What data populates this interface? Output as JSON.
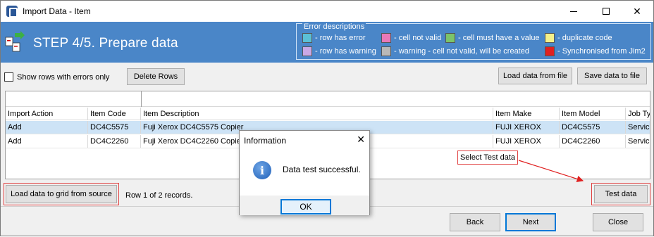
{
  "window": {
    "title": "Import Data - Item"
  },
  "header": {
    "step_title": "STEP 4/5. Prepare data",
    "error_descriptions": {
      "title": "Error descriptions",
      "items": [
        {
          "label": "- row has error",
          "color": "#5bc0d6"
        },
        {
          "label": "- cell not valid",
          "color": "#e879b8"
        },
        {
          "label": "- cell must have a value",
          "color": "#7cc46a"
        },
        {
          "label": "- duplicate code",
          "color": "#f4f08a"
        },
        {
          "label": "- row has warning",
          "color": "#c9a8e6"
        },
        {
          "label": "- warning - cell not valid, will be created",
          "color": "#b8b8b8"
        },
        {
          "label": "- Synchronised from Jim2",
          "color": "#e02020"
        }
      ]
    }
  },
  "toolbar": {
    "show_errors_label": "Show rows with errors only",
    "delete_rows": "Delete Rows",
    "load_from_file": "Load data from file",
    "save_to_file": "Save data to file"
  },
  "grid": {
    "columns": [
      "Import Action",
      "Item Code",
      "Item Description",
      "Item Make",
      "Item Model",
      "Job Ty"
    ],
    "rows": [
      [
        "Add",
        "DC4C5575",
        "Fuji Xerox DC4C5575 Copier",
        "FUJI XEROX",
        "DC4C5575",
        "Service"
      ],
      [
        "Add",
        "DC4C2260",
        "Fuji Xerox DC4C2260 Copier",
        "FUJI XEROX",
        "DC4C2260",
        "Service"
      ]
    ]
  },
  "bottom": {
    "load_grid_from_source": "Load data to grid from source",
    "status": "Row 1 of 2 records.",
    "test_data": "Test data",
    "back": "Back",
    "next": "Next",
    "close": "Close"
  },
  "dialog": {
    "title": "Information",
    "message": "Data test successful.",
    "ok": "OK"
  },
  "annotation": {
    "callout": "Select Test data"
  }
}
